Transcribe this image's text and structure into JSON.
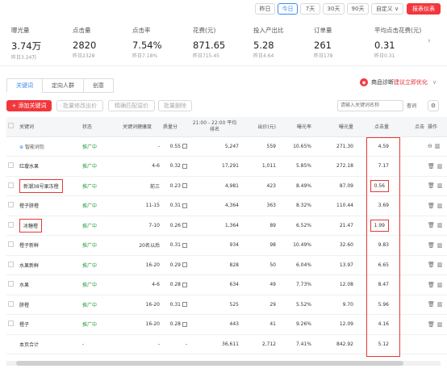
{
  "date_buttons": [
    "昨日",
    "今日",
    "7天",
    "30天",
    "90天"
  ],
  "custom_label": "自定义 ∨",
  "report_button": "报表仪表",
  "metrics": [
    {
      "name": "曝光量",
      "value": "3.74万",
      "prev": "昨日3.24万"
    },
    {
      "name": "点击量",
      "value": "2820",
      "prev": "昨日2328"
    },
    {
      "name": "点击率",
      "value": "7.54%",
      "prev": "昨日7.18%"
    },
    {
      "name": "花费(元)",
      "value": "871.65",
      "prev": "昨日715.45"
    },
    {
      "name": "投入产出比",
      "value": "5.28",
      "prev": "昨日4.64"
    },
    {
      "name": "订单量",
      "value": "261",
      "prev": "昨日178"
    },
    {
      "name": "平均点击花费(元)",
      "value": "0.31",
      "prev": "昨日0.31"
    }
  ],
  "tabs": [
    "关键词",
    "定向人群",
    "创意"
  ],
  "diag": {
    "prefix": "商品诊断",
    "link": "建议立即优化"
  },
  "toolbar": {
    "add": "+ 添加关键词",
    "batch_bid": "批量修改出价",
    "precise_bid": "精确匹配溢价",
    "batch_delete": "批量删除",
    "search_placeholder": "请输入关键词名称",
    "search_btn": "查词"
  },
  "headers": [
    "关键词",
    "状态",
    "关键词健康度",
    "质量分",
    "21:00 - 22:00 平均排名",
    "出价(元)",
    "曝光率",
    "曝光量",
    "点击量",
    "点击",
    "操作"
  ],
  "rows": [
    {
      "kw": "智能词包",
      "status": "推广中",
      "health": "-",
      "quality": "0.55",
      "rank": "5,247",
      "bid": "559",
      "rate": "10.65%",
      "exp": "271.30",
      "clk": "4.59"
    },
    {
      "kw": "红瓊水果",
      "status": "推广中",
      "health": "4-6",
      "quality": "0.32",
      "rank": "17,291",
      "bid": "1,011",
      "rate": "5.85%",
      "exp": "272.18",
      "clk": "7.17"
    },
    {
      "kw": "新潮38号果冻橙",
      "status": "推广中",
      "health": "前三",
      "quality": "0.23",
      "rank": "4,981",
      "bid": "423",
      "rate": "8.49%",
      "exp": "87.09",
      "clk": "0.56"
    },
    {
      "kw": "橙子脐橙",
      "status": "推广中",
      "health": "11-15",
      "quality": "0.31",
      "rank": "4,364",
      "bid": "363",
      "rate": "8.32%",
      "exp": "110.44",
      "clk": "3.69"
    },
    {
      "kw": "冰糖橙",
      "status": "推广中",
      "health": "7-10",
      "quality": "0.26",
      "rank": "1,364",
      "bid": "89",
      "rate": "6.52%",
      "exp": "21.47",
      "clk": "1.99"
    },
    {
      "kw": "橙子新鲜",
      "status": "推广中",
      "health": "20名以后",
      "quality": "0.31",
      "rank": "934",
      "bid": "98",
      "rate": "10.49%",
      "exp": "32.60",
      "clk": "9.83"
    },
    {
      "kw": "水果新鲜",
      "status": "推广中",
      "health": "16-20",
      "quality": "0.29",
      "rank": "828",
      "bid": "50",
      "rate": "6.04%",
      "exp": "13.97",
      "clk": "6.65"
    },
    {
      "kw": "水果",
      "status": "推广中",
      "health": "4-6",
      "quality": "0.28",
      "rank": "634",
      "bid": "49",
      "rate": "7.73%",
      "exp": "12.08",
      "clk": "8.47"
    },
    {
      "kw": "脐橙",
      "status": "推广中",
      "health": "16-20",
      "quality": "0.31",
      "rank": "525",
      "bid": "29",
      "rate": "5.52%",
      "exp": "9.70",
      "clk": "5.96"
    },
    {
      "kw": "橙子",
      "status": "推广中",
      "health": "16-20",
      "quality": "0.28",
      "rank": "443",
      "bid": "41",
      "rate": "9.26%",
      "exp": "12.09",
      "clk": "4.16"
    },
    {
      "kw": "本页合计",
      "status": "-",
      "health": "-",
      "quality": "-",
      "rank": "36,611",
      "bid": "2,712",
      "rate": "7.41%",
      "exp": "842.92",
      "clk": "5.12"
    }
  ]
}
